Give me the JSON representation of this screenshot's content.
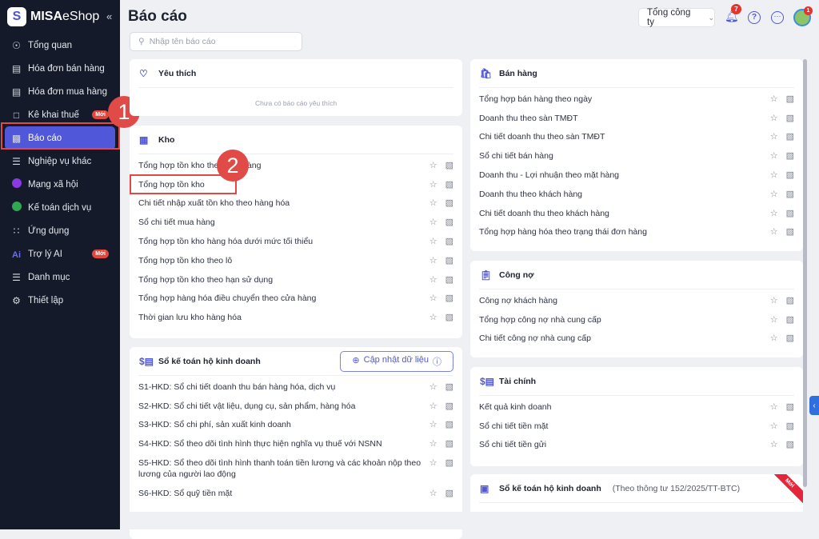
{
  "sidebar": {
    "logo_brand": "MISA",
    "logo_product": "eShop",
    "collapse_icon": "«",
    "items": [
      {
        "label": "Tổng quan",
        "icon": "compass-icon"
      },
      {
        "label": "Hóa đơn bán hàng",
        "icon": "invoice-icon"
      },
      {
        "label": "Hóa đơn mua hàng",
        "icon": "receipt-icon"
      },
      {
        "label": "Kê khai thuế",
        "icon": "tax-icon",
        "badge": "Mới"
      },
      {
        "label": "Báo cáo",
        "icon": "chart-icon",
        "active": true
      },
      {
        "label": "Nghiệp vụ khác",
        "icon": "list-icon"
      },
      {
        "label": "Mạng xã hội",
        "icon": "social-icon"
      },
      {
        "label": "Kế toán dịch vụ",
        "icon": "accounting-icon"
      },
      {
        "label": "Ứng dụng",
        "icon": "apps-icon"
      },
      {
        "label": "Trợ lý AI",
        "icon": "ai-icon",
        "badge": "Mới"
      },
      {
        "label": "Danh mục",
        "icon": "menu-icon"
      },
      {
        "label": "Thiết lập",
        "icon": "gear-icon"
      }
    ]
  },
  "annotations": {
    "step1": "1",
    "step2": "2"
  },
  "header": {
    "title": "Báo cáo",
    "search_placeholder": "Nhập tên báo cáo",
    "company": "Tổng công ty",
    "notification_count": "7",
    "avatar_count": "1"
  },
  "favorites": {
    "title": "Yêu thích",
    "empty": "Chưa có báo cáo yêu thích"
  },
  "kho": {
    "title": "Kho",
    "items": [
      "Tổng hợp tồn kho theo cửa hàng",
      "Tổng hợp tồn kho",
      "Chi tiết nhập xuất tồn kho theo hàng hóa",
      "Sổ chi tiết mua hàng",
      "Tổng hợp tồn kho hàng hóa dưới mức tối thiểu",
      "Tổng hợp tồn kho theo lô",
      "Tổng hợp tồn kho theo hạn sử dụng",
      "Tổng hợp hàng hóa điều chuyển theo cửa hàng",
      "Thời gian lưu kho hàng hóa"
    ]
  },
  "so_ke_toan": {
    "title": "Sổ kế toán hộ kinh doanh",
    "update_button": "Cập nhật dữ liệu",
    "items": [
      "S1-HKD: Sổ chi tiết doanh thu bán hàng hóa, dịch vụ",
      "S2-HKD: Sổ chi tiết vật liệu, dụng cụ, sản phẩm, hàng hóa",
      "S3-HKD: Sổ chi phí, sản xuất kinh doanh",
      "S4-HKD: Sổ theo dõi tình hình thực hiện nghĩa vụ thuế với NSNN",
      "S5-HKD: Sổ theo dõi tình hình thanh toán tiền lương và các khoản nộp theo lương của người lao động",
      "S6-HKD: Sổ quỹ tiền mặt"
    ]
  },
  "ban_hang": {
    "title": "Bán hàng",
    "items": [
      "Tổng hợp bán hàng theo ngày",
      "Doanh thu theo sàn TMĐT",
      "Chi tiết doanh thu theo sàn TMĐT",
      "Sổ chi tiết bán hàng",
      "Doanh thu - Lợi nhuận theo mặt hàng",
      "Doanh thu theo khách hàng",
      "Chi tiết doanh thu theo khách hàng",
      "Tổng hợp hàng hóa theo trạng thái đơn hàng"
    ]
  },
  "cong_no": {
    "title": "Công nợ",
    "items": [
      "Công nợ khách hàng",
      "Tổng hợp công nợ nhà cung cấp",
      "Chi tiết công nợ nhà cung cấp"
    ]
  },
  "tai_chinh": {
    "title": "Tài chính",
    "items": [
      "Kết quả kinh doanh",
      "Sổ chi tiết tiền mặt",
      "Sổ chi tiết tiền gửi"
    ]
  },
  "so_ke_toan_new": {
    "title": "Sổ kế toán hộ kinh doanh",
    "subtitle": "(Theo thông tư 152/2025/TT-BTC)",
    "ribbon": "Mới"
  },
  "colors": {
    "accent": "#5158d8",
    "sidebar_bg": "#141a29",
    "highlight": "#e04a43"
  }
}
